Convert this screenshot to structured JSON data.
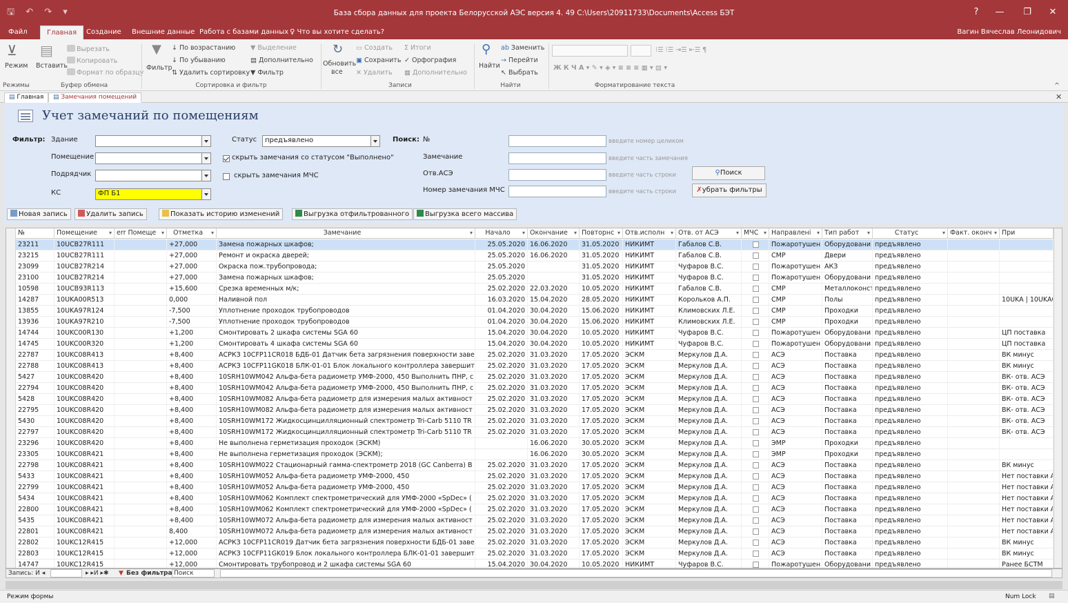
{
  "titlebar": {
    "qat": "🖫 ↶ ↷ ▾",
    "title": "База сбора данных для проекта Белорусской АЭС версия 4. 49 C:\\Users\\20911733\\Documents\\Access БЭТ",
    "help": "?",
    "min": "—",
    "max": "❐",
    "close": "✕"
  },
  "menu": {
    "items": [
      "Файл",
      "Главная",
      "Создание",
      "Внешние данные",
      "Работа с базами данных",
      "♀ Что вы хотите сделать?"
    ],
    "user": "Вагин Вячеслав Леонидович"
  },
  "ribbon": {
    "view": "Режим",
    "paste": "Вставить",
    "cut": "Вырезать",
    "copy": "Копировать",
    "format_painter": "Формат по образцу",
    "filter": "Фильтр",
    "asc": "По возрастанию",
    "desc": "По убыванию",
    "remove_sort": "Удалить сортировку",
    "selection": "Выделение",
    "advanced": "Дополнительно",
    "toggle_filter": "Фильтр",
    "refresh": "Обновить",
    "refresh2": "все",
    "new": "Создать",
    "save": "Сохранить",
    "delete": "Удалить",
    "totals": "Итоги",
    "spelling": "Орфография",
    "more": "Дополнительно",
    "find": "Найти",
    "replace": "Заменить",
    "goto": "Перейти",
    "select": "Выбрать",
    "groups": {
      "views": "Режимы",
      "clipboard": "Буфер обмена",
      "sort": "Сортировка и фильтр",
      "records": "Записи",
      "find": "Найти",
      "text": "Форматирование текста"
    }
  },
  "doc_tabs": [
    "Главная",
    "Замечания помещений"
  ],
  "form": {
    "title": "Учет замечаний по помещениям",
    "filter_label": "Фильтр:",
    "building_label": "Здание",
    "room_label": "Помещение",
    "contractor_label": "Подрядчик",
    "ks_label": "КС",
    "ks_value": "ФП Б1",
    "status_label": "Статус",
    "status_value": "предъявлено",
    "hide_done": "скрыть замечания со статусом \"Выполнено\"",
    "hide_mchs": "скрыть замечания МЧС",
    "search_label": "Поиск:",
    "no_label": "№",
    "remark_label": "Замечание",
    "asce_label": "Отв.АСЭ",
    "mchs_no_label": "Номер замечания МЧС",
    "hint_no": "введите номер целиком",
    "hint_remark": "введите часть замечания",
    "hint_asce": "введите часть строки",
    "hint_mchs": "введите часть строки",
    "search_btn": "Поиск",
    "clear_btn": "убрать фильтры",
    "new_record": "Новая запись",
    "delete_record": "Удалить запись",
    "history": "Показать историю изменений",
    "export_filtered": "Выгрузка отфильтрованного",
    "export_all": "Выгрузка всего массива"
  },
  "table": {
    "headers": [
      "№",
      "Помещение",
      "err Помеще",
      "Отметка",
      "Замечание",
      "Начало",
      "Окончание",
      "Повторнс",
      "Отв.исполн",
      "Отв. от АСЭ",
      "МЧС",
      "Направлені",
      "Тип работ",
      "Статус",
      "Факт. оконч",
      "При"
    ],
    "rows": [
      [
        "23211",
        "10UCB27R111",
        "",
        "+27,000",
        "Замена пожарных шкафов;",
        "25.05.2020",
        "16.06.2020",
        "31.05.2020",
        "НИКИМТ",
        "Габалов С.В.",
        "",
        "Пожаротушен",
        "Оборудовани",
        "предъявлено",
        "",
        ""
      ],
      [
        "23215",
        "10UCB27R111",
        "",
        "+27,000",
        "Ремонт и окраска дверей;",
        "25.05.2020",
        "16.06.2020",
        "31.05.2020",
        "НИКИМТ",
        "Габалов С.В.",
        "",
        "СМР",
        "Двери",
        "предъявлено",
        "",
        ""
      ],
      [
        "23099",
        "10UCB27R214",
        "",
        "+27,000",
        "Окраска пож.трубопровода;",
        "25.05.2020",
        "",
        "31.05.2020",
        "НИКИМТ",
        "Чуфаров В.С.",
        "",
        "Пожаротушен",
        "АКЗ",
        "предъявлено",
        "",
        ""
      ],
      [
        "23100",
        "10UCB27R214",
        "",
        "+27,000",
        "Замена пожарных шкафов;",
        "25.05.2020",
        "",
        "31.05.2020",
        "НИКИМТ",
        "Чуфаров В.С.",
        "",
        "Пожаротушен",
        "Оборудовани",
        "предъявлено",
        "",
        ""
      ],
      [
        "10598",
        "10UCB93R113",
        "",
        "+15,600",
        "Срезка временных м/к;",
        "25.02.2020",
        "22.03.2020",
        "10.05.2020",
        "НИКИМТ",
        "Габалов С.В.",
        "",
        "СМР",
        "Металлоконст",
        "предъявлено",
        "",
        ""
      ],
      [
        "14287",
        "10UKA00R513",
        "",
        "0,000",
        "Наливной пол",
        "16.03.2020",
        "15.04.2020",
        "28.05.2020",
        "НИКИМТ",
        "Корольков А.П.",
        "",
        "СМР",
        "Полы",
        "предъявлено",
        "",
        "10UKA | 10UKA0"
      ],
      [
        "13855",
        "10UKA97R124",
        "",
        "-7,500",
        "Уплотнение проходок трубопроводов",
        "01.04.2020",
        "30.04.2020",
        "15.06.2020",
        "НИКИМТ",
        "Климовских Л.Е.",
        "",
        "СМР",
        "Проходки",
        "предъявлено",
        "",
        ""
      ],
      [
        "13936",
        "10UKA97R210",
        "",
        "-7,500",
        "Уплотнение проходок трубопроводов",
        "01.04.2020",
        "30.04.2020",
        "15.06.2020",
        "НИКИМТ",
        "Климовских Л.Е.",
        "",
        "СМР",
        "Проходки",
        "предъявлено",
        "",
        ""
      ],
      [
        "14744",
        "10UKC00R130",
        "",
        "+1,200",
        "Смонтировать 2 шкафа системы SGA 60",
        "15.04.2020",
        "30.04.2020",
        "10.05.2020",
        "НИКИМТ",
        "Чуфаров В.С.",
        "",
        "Пожаротушен",
        "Оборудовани",
        "предъявлено",
        "",
        "ЦП поставка"
      ],
      [
        "14745",
        "10UKC00R320",
        "",
        "+1,200",
        "Смонтировать 4 шкафа системы SGA 60",
        "15.04.2020",
        "30.04.2020",
        "10.05.2020",
        "НИКИМТ",
        "Чуфаров В.С.",
        "",
        "Пожаротушен",
        "Оборудовани",
        "предъявлено",
        "",
        "ЦП поставка"
      ],
      [
        "22787",
        "10UKC08R413",
        "",
        "+8,400",
        "АСРКЗ 10CFP11CR018 БДБ-01 Датчик бета загрязнения поверхности заве",
        "25.02.2020",
        "31.03.2020",
        "17.05.2020",
        "ЭСКМ",
        "Меркулов Д.А.",
        "",
        "АСЭ",
        "Поставка",
        "предъявлено",
        "",
        "ВК минус"
      ],
      [
        "22788",
        "10UKC08R413",
        "",
        "+8,400",
        "АСРКЗ 10CFP11GK018 БЛК-01-01 Блок локального контроллера завершит",
        "25.02.2020",
        "31.03.2020",
        "17.05.2020",
        "ЭСКМ",
        "Меркулов Д.А.",
        "",
        "АСЭ",
        "Поставка",
        "предъявлено",
        "",
        "ВК минус"
      ],
      [
        "5427",
        "10UKC08R420",
        "",
        "+8,400",
        "10SRH10WM042 Альфа-бета радиометр УМФ-2000, 450 Выполнить ПНР, с",
        "25.02.2020",
        "31.03.2020",
        "17.05.2020",
        "ЭСКМ",
        "Меркулов Д.А.",
        "",
        "АСЭ",
        "Поставка",
        "предъявлено",
        "",
        "ВК- отв. АСЭ"
      ],
      [
        "22794",
        "10UKC08R420",
        "",
        "+8,400",
        "10SRH10WM042 Альфа-бета радиометр УМФ-2000, 450 Выполнить ПНР, с",
        "25.02.2020",
        "31.03.2020",
        "17.05.2020",
        "ЭСКМ",
        "Меркулов Д.А.",
        "",
        "АСЭ",
        "Поставка",
        "предъявлено",
        "",
        "ВК- отв. АСЭ"
      ],
      [
        "5428",
        "10UKC08R420",
        "",
        "+8,400",
        "10SRH10WM082 Альфа-бета радиометр для измерения малых активност",
        "25.02.2020",
        "31.03.2020",
        "17.05.2020",
        "ЭСКМ",
        "Меркулов Д.А.",
        "",
        "АСЭ",
        "Поставка",
        "предъявлено",
        "",
        "ВК- отв. АСЭ"
      ],
      [
        "22795",
        "10UKC08R420",
        "",
        "+8,400",
        "10SRH10WM082 Альфа-бета радиометр для измерения малых активност",
        "25.02.2020",
        "31.03.2020",
        "17.05.2020",
        "ЭСКМ",
        "Меркулов Д.А.",
        "",
        "АСЭ",
        "Поставка",
        "предъявлено",
        "",
        "ВК- отв. АСЭ"
      ],
      [
        "5430",
        "10UKC08R420",
        "",
        "+8,400",
        "10SRH10WM172 Жидкосцинцилляционный спектрометр Tri-Carb 5110 TR",
        "25.02.2020",
        "31.03.2020",
        "17.05.2020",
        "ЭСКМ",
        "Меркулов Д.А.",
        "",
        "АСЭ",
        "Поставка",
        "предъявлено",
        "",
        "ВК- отв. АСЭ"
      ],
      [
        "22797",
        "10UKC08R420",
        "",
        "+8,400",
        "10SRH10WM172 Жидкосцинцилляционный спектрометр Tri-Carb 5110 TR",
        "25.02.2020",
        "31.03.2020",
        "17.05.2020",
        "ЭСКМ",
        "Меркулов Д.А.",
        "",
        "АСЭ",
        "Поставка",
        "предъявлено",
        "",
        "ВК- отв. АСЭ"
      ],
      [
        "23296",
        "10UKC08R420",
        "",
        "+8,400",
        "Не выполнена герметизация проходок (ЭСКМ)",
        "",
        "16.06.2020",
        "30.05.2020",
        "ЭСКМ",
        "Меркулов Д.А.",
        "",
        "ЭМР",
        "Проходки",
        "предъявлено",
        "",
        ""
      ],
      [
        "23305",
        "10UKC08R421",
        "",
        "+8,400",
        "Не выполнена герметизация проходок (ЭСКМ);",
        "",
        "16.06.2020",
        "30.05.2020",
        "ЭСКМ",
        "Меркулов Д.А.",
        "",
        "ЭМР",
        "Проходки",
        "предъявлено",
        "",
        ""
      ],
      [
        "22798",
        "10UKC08R421",
        "",
        "+8,400",
        "10SRH10WM022 Стационарный гамма-спектрометр 2018 (GC Canberra) B",
        "25.02.2020",
        "31.03.2020",
        "17.05.2020",
        "ЭСКМ",
        "Меркулов Д.А.",
        "",
        "АСЭ",
        "Поставка",
        "предъявлено",
        "",
        "ВК минус"
      ],
      [
        "5433",
        "10UKC08R421",
        "",
        "+8,400",
        "10SRH10WM052 Альфа-бета радиометр УМФ-2000, 450",
        "25.02.2020",
        "31.03.2020",
        "17.05.2020",
        "ЭСКМ",
        "Меркулов Д.А.",
        "",
        "АСЭ",
        "Поставка",
        "предъявлено",
        "",
        "Нет поставки АС"
      ],
      [
        "22799",
        "10UKC08R421",
        "",
        "+8,400",
        "10SRH10WM052 Альфа-бета радиометр УМФ-2000, 450",
        "25.02.2020",
        "31.03.2020",
        "17.05.2020",
        "ЭСКМ",
        "Меркулов Д.А.",
        "",
        "АСЭ",
        "Поставка",
        "предъявлено",
        "",
        "Нет поставки АС"
      ],
      [
        "5434",
        "10UKC08R421",
        "",
        "+8,400",
        "10SRH10WM062 Комплект спектрометрический для УМФ-2000 «SpDec» (",
        "25.02.2020",
        "31.03.2020",
        "17.05.2020",
        "ЭСКМ",
        "Меркулов Д.А.",
        "",
        "АСЭ",
        "Поставка",
        "предъявлено",
        "",
        "Нет поставки АС"
      ],
      [
        "22800",
        "10UKC08R421",
        "",
        "+8,400",
        "10SRH10WM062 Комплект спектрометрический для УМФ-2000 «SpDec» (",
        "25.02.2020",
        "31.03.2020",
        "17.05.2020",
        "ЭСКМ",
        "Меркулов Д.А.",
        "",
        "АСЭ",
        "Поставка",
        "предъявлено",
        "",
        "Нет поставки АС"
      ],
      [
        "5435",
        "10UKC08R421",
        "",
        "+8,400",
        "10SRH10WM072 Альфа-бета радиометр для измерения малых активност",
        "25.02.2020",
        "31.03.2020",
        "17.05.2020",
        "ЭСКМ",
        "Меркулов Д.А.",
        "",
        "АСЭ",
        "Поставка",
        "предъявлено",
        "",
        "Нет поставки АС"
      ],
      [
        "22801",
        "10UKC08R421",
        "",
        "8,400",
        "10SRH10WM072 Альфа-бета радиометр для измерения малых активност",
        "25.02.2020",
        "31.03.2020",
        "17.05.2020",
        "ЭСКМ",
        "Меркулов Д.А.",
        "",
        "АСЭ",
        "Поставка",
        "предъявлено",
        "",
        "Нет поставки АС"
      ],
      [
        "22802",
        "10UKC12R415",
        "",
        "+12,000",
        "АСРКЗ 10CFP11CR019 Датчик бета загрязнения поверхности БДБ-01 заве",
        "25.02.2020",
        "31.03.2020",
        "17.05.2020",
        "ЭСКМ",
        "Меркулов Д.А.",
        "",
        "АСЭ",
        "Поставка",
        "предъявлено",
        "",
        "ВК минус"
      ],
      [
        "22803",
        "10UKC12R415",
        "",
        "+12,000",
        "АСРКЗ 10CFP11GK019 Блок локального контроллера БЛК-01-01 завершит",
        "25.02.2020",
        "31.03.2020",
        "17.05.2020",
        "ЭСКМ",
        "Меркулов Д.А.",
        "",
        "АСЭ",
        "Поставка",
        "предъявлено",
        "",
        "ВК минус"
      ],
      [
        "14747",
        "10UKC12R415",
        "",
        "+12,000",
        "Смонтировать трубопровод и 2 шкафа системы SGA 60",
        "15.04.2020",
        "30.04.2020",
        "10.05.2020",
        "НИКИМТ",
        "Чуфаров В.С.",
        "",
        "Пожаротушен",
        "Оборудовани",
        "предъявлено",
        "",
        "Ранее БСТМ"
      ]
    ]
  },
  "nav": {
    "record": "Запись: И ◂",
    "arrows": "▸ ▸И ▸✱",
    "nofilter": "Без фильтра",
    "search": "Поиск"
  },
  "status": {
    "mode": "Режим формы",
    "numlock": "Num Lock"
  }
}
